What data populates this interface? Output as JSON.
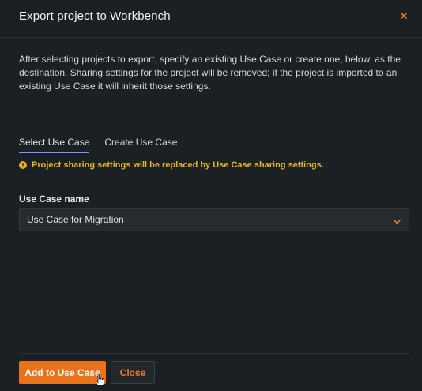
{
  "dialog": {
    "title": "Export project to Workbench",
    "description": "After selecting projects to export, specify an existing Use Case or create one, below, as the destination. Sharing settings for the project will be removed; if the project is imported to an existing Use Case it will inherit those settings."
  },
  "tabs": [
    {
      "label": "Select Use Case",
      "active": true
    },
    {
      "label": "Create Use Case",
      "active": false
    }
  ],
  "warning": {
    "icon": "warning-circle-icon",
    "text": "Project sharing settings will be replaced by Use Case sharing settings.",
    "color": "#e9b521"
  },
  "use_case_field": {
    "label": "Use Case name",
    "selected_value": "Use Case for Migration"
  },
  "footer": {
    "primary_label": "Add to Use Case",
    "secondary_label": "Close"
  },
  "colors": {
    "background": "#1b2024",
    "accent": "#e9721c",
    "tab_underline": "#7e97ff",
    "warning": "#e9b521"
  }
}
